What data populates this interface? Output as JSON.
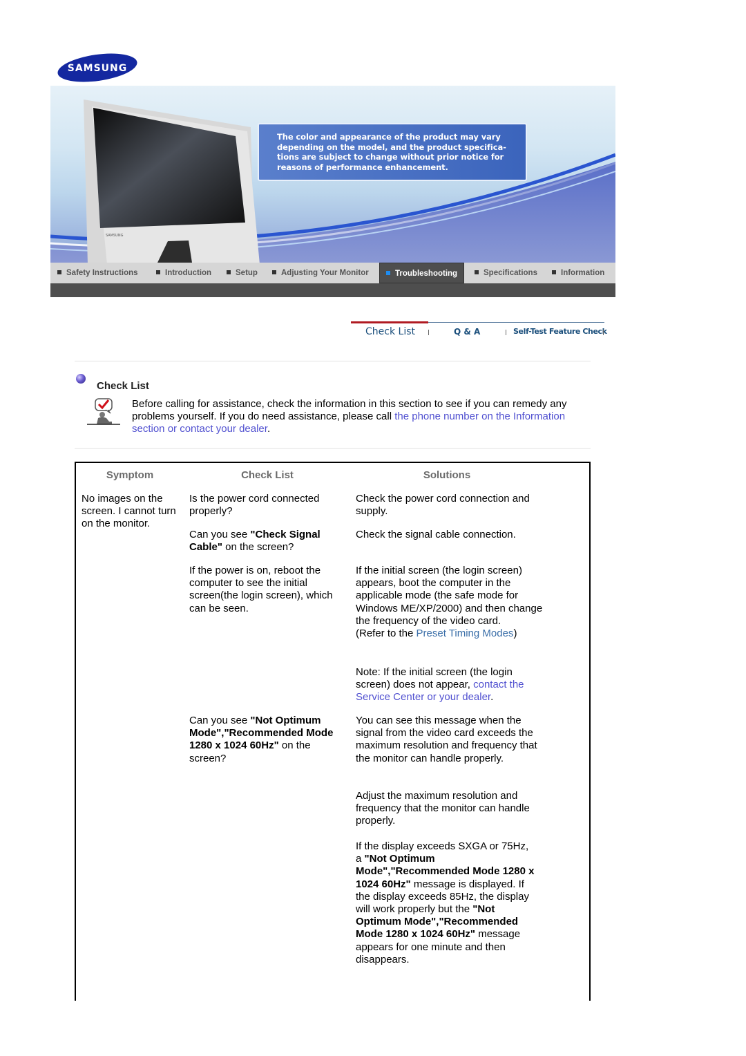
{
  "brand": {
    "logo_text": "SAMSUNG",
    "logo_color": "#1428a0"
  },
  "banner": {
    "notice_lines": [
      "The color and appearance of the product may vary",
      "depending on the model, and the product specifica-",
      "tions are subject to change without prior notice for",
      "reasons of performance enhancement."
    ]
  },
  "nav": {
    "items": [
      {
        "label": "Safety Instructions",
        "active": false
      },
      {
        "label": "Introduction",
        "active": false
      },
      {
        "label": "Setup",
        "active": false
      },
      {
        "label": "Adjusting Your Monitor",
        "active": false
      },
      {
        "label": "Troubleshooting",
        "active": true
      },
      {
        "label": "Specifications",
        "active": false
      },
      {
        "label": "Information",
        "active": false
      }
    ]
  },
  "subtabs": [
    {
      "label": "Check List",
      "active": true
    },
    {
      "label": "Q & A",
      "active": false
    },
    {
      "label": "Self-Test Feature Check",
      "active": false
    }
  ],
  "section": {
    "title": "Check List",
    "intro_text": "Before calling for assistance, check the information in this section to see if you can remedy any problems yourself. If you do need assistance, please call ",
    "intro_link": "the phone number on the Information section or contact your dealer",
    "intro_end": "."
  },
  "table": {
    "headers": {
      "symptom": "Symptom",
      "checklist": "Check List",
      "solutions": "Solutions"
    },
    "symptom": "No images on the screen. I cannot turn on the monitor.",
    "rows": [
      {
        "check": "Is the power cord connected properly?",
        "solution": "Check the power cord connection and supply."
      },
      {
        "check_pre": "Can you see ",
        "check_bold": "\"Check Signal Cable\"",
        "check_post": " on the screen?",
        "solution": "Check the signal cable connection."
      },
      {
        "check": "If the power is on, reboot the computer to see the initial screen(the login screen), which can be seen.",
        "solution": "If the initial screen (the login screen) appears, boot the computer in the applicable mode (the safe mode for Windows ME/XP/2000) and then change the frequency of the video card.",
        "refer_pre": "(Refer to the ",
        "refer_link": "Preset Timing Modes",
        "refer_post": ")",
        "note_pre": "Note: If the initial screen (the login screen) does not appear, ",
        "note_link": "contact the Service Center or your dealer",
        "note_post": "."
      },
      {
        "check_pre": "Can you see ",
        "check_bold": "\"Not Optimum Mode\",\"Recommended Mode 1280 x 1024 60Hz\"",
        "check_post": " on the screen?",
        "solution_1": "You can see this message when the signal from the video card exceeds the maximum resolution and frequency that the monitor can handle properly.",
        "solution_2": "Adjust the maximum resolution and frequency that the monitor can handle properly.",
        "solution_3_a": "If the display exceeds SXGA or 75Hz, a ",
        "solution_3_b": "\"Not Optimum Mode\",\"Recommended Mode 1280 x 1024 60Hz\"",
        "solution_3_c": " message is displayed. If the display exceeds 85Hz, the display will work properly but the ",
        "solution_3_d": "\"Not Optimum Mode\",\"Recommended Mode 1280 x 1024 60Hz\"",
        "solution_3_e": " message appears for one minute and then disappears."
      }
    ]
  }
}
